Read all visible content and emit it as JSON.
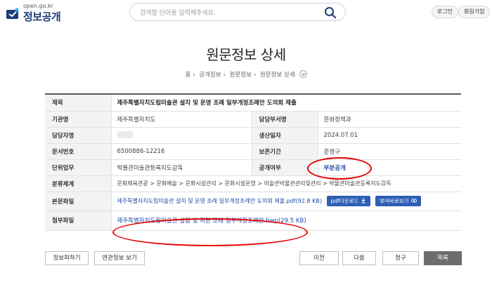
{
  "header": {
    "logo_url": "open.go.kr",
    "logo_title": "정보공개",
    "search_placeholder": "검색할 단어를 입력해주세요.",
    "login_label": "로그인",
    "join_label": "회원가입"
  },
  "page": {
    "title": "원문정보 상세",
    "breadcrumb": [
      "홈",
      "공개정보",
      "원문정보",
      "원문정보 상세"
    ]
  },
  "detail": {
    "title_label": "제목",
    "title_value": "제주특별자치도립미술관 설치 및 운영 조례 일부개정조례안 도의회 제출",
    "org_label": "기관명",
    "org_value": "제주특별자치도",
    "dept_label": "담당부서명",
    "dept_value": "문화정책과",
    "owner_label": "담당자명",
    "date_label": "생산일자",
    "date_value": "2024.07.01",
    "docno_label": "문서번호",
    "docno_value": "6500886-12216",
    "retention_label": "보존기간",
    "retention_value": "준영구",
    "unit_label": "단위업무",
    "unit_value": "박물관미술관등록지도감독",
    "open_label": "공개여부",
    "open_value": "부분공개",
    "class_label": "분류체계",
    "class_value": "문화체육관광 > 문화예술 > 문화시설관리 > 문화시설운영 > 미술관박물관관리및관리 > 박물관미술관등록지도감독",
    "file_label": "본문파일",
    "file_value": "제주특별자치도립미술관 설치 및 운영 조례 일부개정조례안 도의회 제출.pdf(92.8 KB)",
    "download_label": "pdf다운로드",
    "preview_label": "뷰어바로보기",
    "attach_label": "첨부파일",
    "attach_value": "제주특별자치도립미술관 설립 및 지원 조례 일부개정조례안.hwp(29.5 KB)"
  },
  "buttons": {
    "share": "정보퍼하기",
    "related": "연관정보 보기",
    "prev": "이전",
    "next": "다음",
    "request": "청구",
    "list": "목록"
  },
  "colors": {
    "accent": "#2d5fb5",
    "annotation": "#e60000",
    "list_button": "#6d6d6d"
  }
}
